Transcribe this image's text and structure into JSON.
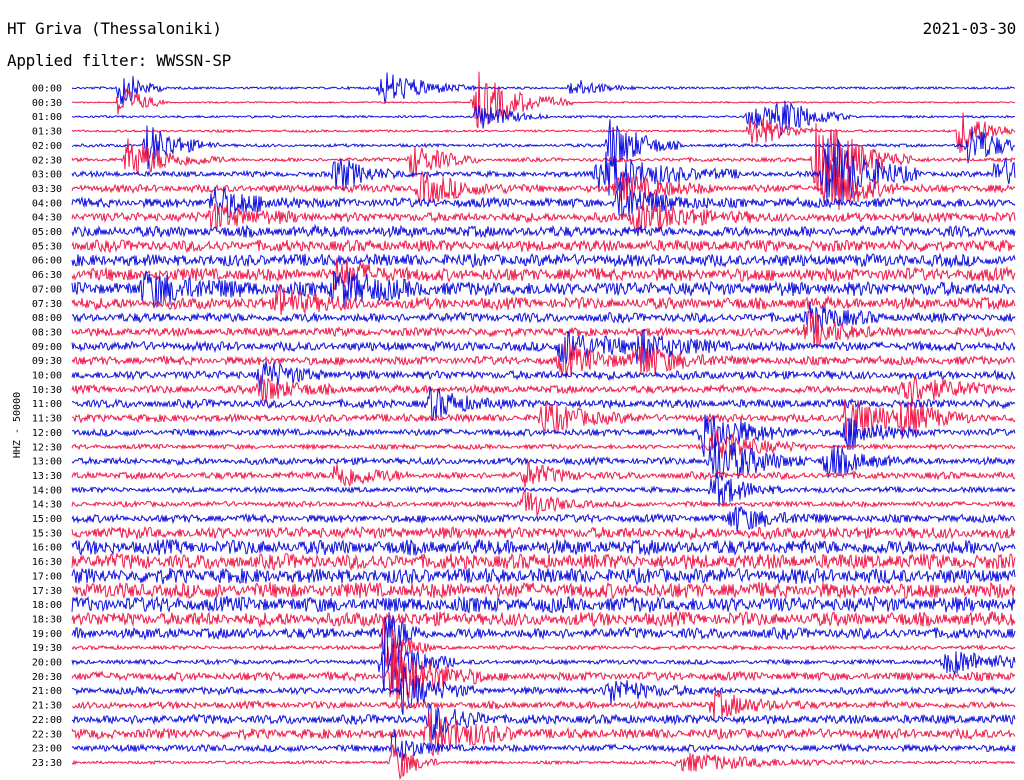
{
  "header": {
    "station": "HT Griva (Thessaloniki)",
    "date": "2021-03-30",
    "filter": "Applied filter: WWSSN-SP"
  },
  "colors": {
    "series_a": "#1010e0",
    "series_b": "#f01a4a",
    "text": "#000000"
  },
  "chart_data": {
    "type": "line",
    "ylabel": "HHZ - 50000",
    "series_colors_alternate": [
      "#1010e0",
      "#f01a4a"
    ],
    "rows": [
      {
        "time": "00:00",
        "noise": 0.15,
        "events": [
          [
            0.33,
            1.2,
            0.04
          ],
          [
            0.05,
            1.5,
            0.02
          ],
          [
            0.53,
            0.6,
            0.03
          ]
        ]
      },
      {
        "time": "00:30",
        "noise": 0.1,
        "events": [
          [
            0.43,
            2.0,
            0.04
          ],
          [
            0.05,
            1.5,
            0.02
          ]
        ]
      },
      {
        "time": "01:00",
        "noise": 0.15,
        "events": [
          [
            0.43,
            1.0,
            0.03
          ],
          [
            0.72,
            0.8,
            0.04
          ],
          [
            0.75,
            1.0,
            0.03
          ]
        ]
      },
      {
        "time": "01:30",
        "noise": 0.15,
        "events": [
          [
            0.72,
            1.2,
            0.03
          ],
          [
            0.94,
            1.5,
            0.03
          ]
        ]
      },
      {
        "time": "02:00",
        "noise": 0.2,
        "events": [
          [
            0.08,
            1.5,
            0.03
          ],
          [
            0.57,
            2.0,
            0.03
          ],
          [
            0.95,
            1.5,
            0.03
          ]
        ]
      },
      {
        "time": "02:30",
        "noise": 0.25,
        "events": [
          [
            0.06,
            1.4,
            0.04
          ],
          [
            0.36,
            1.2,
            0.03
          ],
          [
            0.79,
            3.0,
            0.04
          ]
        ]
      },
      {
        "time": "03:00",
        "noise": 0.35,
        "events": [
          [
            0.28,
            1.2,
            0.03
          ],
          [
            0.56,
            1.5,
            0.06
          ],
          [
            0.8,
            3.0,
            0.04
          ],
          [
            0.98,
            1.2,
            0.03
          ]
        ]
      },
      {
        "time": "03:30",
        "noise": 0.5,
        "events": [
          [
            0.37,
            1.0,
            0.04
          ],
          [
            0.58,
            1.0,
            0.04
          ],
          [
            0.8,
            2.0,
            0.03
          ]
        ]
      },
      {
        "time": "04:00",
        "noise": 0.6,
        "events": [
          [
            0.15,
            1.0,
            0.04
          ],
          [
            0.58,
            1.2,
            0.04
          ]
        ]
      },
      {
        "time": "04:30",
        "noise": 0.6,
        "events": [
          [
            0.15,
            0.8,
            0.04
          ],
          [
            0.6,
            1.0,
            0.05
          ]
        ]
      },
      {
        "time": "05:00",
        "noise": 0.7,
        "events": []
      },
      {
        "time": "05:30",
        "noise": 0.75,
        "events": []
      },
      {
        "time": "06:00",
        "noise": 0.8,
        "events": []
      },
      {
        "time": "06:30",
        "noise": 0.85,
        "events": [
          [
            0.28,
            1.0,
            0.03
          ]
        ]
      },
      {
        "time": "07:00",
        "noise": 0.9,
        "events": [
          [
            0.08,
            1.0,
            0.05
          ],
          [
            0.28,
            1.2,
            0.04
          ]
        ]
      },
      {
        "time": "07:30",
        "noise": 0.75,
        "events": [
          [
            0.22,
            1.0,
            0.03
          ]
        ]
      },
      {
        "time": "08:00",
        "noise": 0.6,
        "events": [
          [
            0.78,
            1.0,
            0.03
          ]
        ]
      },
      {
        "time": "08:30",
        "noise": 0.55,
        "events": [
          [
            0.78,
            1.2,
            0.03
          ]
        ]
      },
      {
        "time": "09:00",
        "noise": 0.6,
        "events": [
          [
            0.52,
            1.2,
            0.04
          ],
          [
            0.6,
            1.0,
            0.04
          ]
        ]
      },
      {
        "time": "09:30",
        "noise": 0.55,
        "events": [
          [
            0.52,
            1.0,
            0.04
          ],
          [
            0.6,
            1.0,
            0.04
          ]
        ]
      },
      {
        "time": "10:00",
        "noise": 0.55,
        "events": [
          [
            0.2,
            1.0,
            0.03
          ]
        ]
      },
      {
        "time": "10:30",
        "noise": 0.5,
        "events": [
          [
            0.88,
            1.2,
            0.04
          ],
          [
            0.2,
            0.9,
            0.03
          ]
        ]
      },
      {
        "time": "11:00",
        "noise": 0.55,
        "events": [
          [
            0.38,
            1.0,
            0.03
          ]
        ]
      },
      {
        "time": "11:30",
        "noise": 0.5,
        "events": [
          [
            0.82,
            1.5,
            0.04
          ],
          [
            0.5,
            1.0,
            0.04
          ],
          [
            0.88,
            1.0,
            0.03
          ]
        ]
      },
      {
        "time": "12:00",
        "noise": 0.45,
        "events": [
          [
            0.67,
            1.5,
            0.04
          ],
          [
            0.82,
            1.2,
            0.03
          ]
        ]
      },
      {
        "time": "12:30",
        "noise": 0.3,
        "events": [
          [
            0.68,
            1.2,
            0.04
          ]
        ]
      },
      {
        "time": "13:00",
        "noise": 0.45,
        "events": [
          [
            0.68,
            1.8,
            0.04
          ],
          [
            0.8,
            1.2,
            0.03
          ]
        ]
      },
      {
        "time": "13:30",
        "noise": 0.45,
        "events": [
          [
            0.28,
            1.0,
            0.03
          ],
          [
            0.48,
            0.8,
            0.03
          ]
        ]
      },
      {
        "time": "14:00",
        "noise": 0.35,
        "events": [
          [
            0.68,
            1.2,
            0.03
          ]
        ]
      },
      {
        "time": "14:30",
        "noise": 0.35,
        "events": [
          [
            0.48,
            0.9,
            0.03
          ]
        ]
      },
      {
        "time": "15:00",
        "noise": 0.5,
        "events": [
          [
            0.7,
            0.8,
            0.04
          ]
        ]
      },
      {
        "time": "15:30",
        "noise": 0.75,
        "events": []
      },
      {
        "time": "16:00",
        "noise": 0.95,
        "events": []
      },
      {
        "time": "16:30",
        "noise": 1.0,
        "events": []
      },
      {
        "time": "17:00",
        "noise": 1.0,
        "events": []
      },
      {
        "time": "17:30",
        "noise": 1.0,
        "events": []
      },
      {
        "time": "18:00",
        "noise": 1.0,
        "events": []
      },
      {
        "time": "18:30",
        "noise": 0.9,
        "events": []
      },
      {
        "time": "19:00",
        "noise": 0.7,
        "events": [
          [
            0.33,
            1.5,
            0.02
          ]
        ]
      },
      {
        "time": "19:30",
        "noise": 0.25,
        "events": [
          [
            0.33,
            2.0,
            0.02
          ]
        ]
      },
      {
        "time": "20:00",
        "noise": 0.3,
        "events": [
          [
            0.33,
            2.5,
            0.03
          ],
          [
            0.93,
            0.8,
            0.06
          ]
        ]
      },
      {
        "time": "20:30",
        "noise": 0.55,
        "events": [
          [
            0.34,
            2.2,
            0.04
          ]
        ]
      },
      {
        "time": "21:00",
        "noise": 0.45,
        "events": [
          [
            0.35,
            1.5,
            0.03
          ],
          [
            0.57,
            0.8,
            0.04
          ]
        ]
      },
      {
        "time": "21:30",
        "noise": 0.45,
        "events": [
          [
            0.68,
            0.8,
            0.04
          ]
        ]
      },
      {
        "time": "22:00",
        "noise": 0.6,
        "events": [
          [
            0.38,
            1.2,
            0.03
          ]
        ]
      },
      {
        "time": "22:30",
        "noise": 0.65,
        "events": [
          [
            0.38,
            1.5,
            0.04
          ]
        ]
      },
      {
        "time": "23:00",
        "noise": 0.45,
        "events": [
          [
            0.34,
            1.2,
            0.02
          ]
        ]
      },
      {
        "time": "23:30",
        "noise": 0.2,
        "events": [
          [
            0.65,
            0.6,
            0.08
          ],
          [
            0.34,
            1.5,
            0.02
          ]
        ]
      }
    ]
  }
}
